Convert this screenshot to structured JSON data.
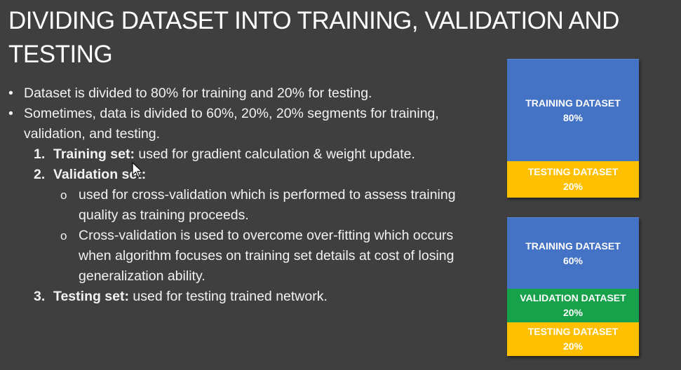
{
  "slide": {
    "title": "DIVIDING DATASET INTO TRAINING, VALIDATION AND TESTING",
    "bullets": [
      "Dataset is divided to 80% for training and 20% for testing.",
      "Sometimes, data is divided to 60%, 20%, 20% segments for training, validation, and testing."
    ],
    "bullet_glyph": "•",
    "numbered": [
      {
        "num": "1.",
        "label": "Training set:",
        "text": " used for gradient calculation & weight update."
      },
      {
        "num": "2.",
        "label": "Validation set:",
        "text": "",
        "sub": [
          "used for cross-validation which is performed to assess training quality as training proceeds.",
          "Cross-validation is used to overcome over-fitting which occurs when algorithm focuses on training set details at cost of losing generalization ability."
        ]
      },
      {
        "num": "3.",
        "label": "Testing set:",
        "text": " used for testing trained network."
      }
    ],
    "sub_glyph": "o"
  },
  "split_80_20": {
    "training": {
      "label": "TRAINING DATASET",
      "pct": "80%"
    },
    "testing": {
      "label": "TESTING DATASET",
      "pct": "20%"
    }
  },
  "split_60_20_20": {
    "training": {
      "label": "TRAINING DATASET",
      "pct": "60%"
    },
    "validation": {
      "label": "VALIDATION DATASET",
      "pct": "20%"
    },
    "testing": {
      "label": "TESTING DATASET",
      "pct": "20%"
    }
  },
  "colors": {
    "background": "#3f3f3f",
    "training": "#4472c4",
    "testing": "#ffc000",
    "validation": "#17a14a",
    "text": "#ffffff"
  },
  "icons": {
    "cursor": "mouse-pointer-icon"
  }
}
